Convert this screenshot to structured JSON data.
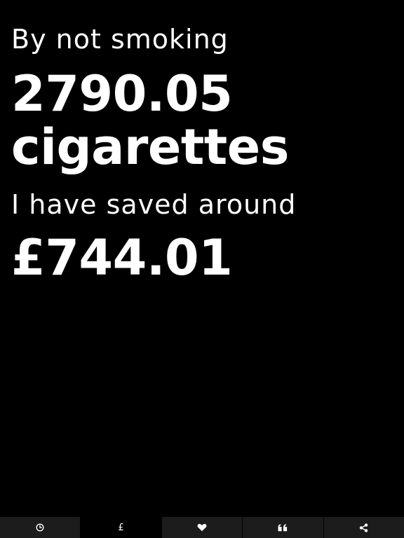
{
  "intro": "By not smoking",
  "cigarettes": {
    "count": "2790.05",
    "unit": "cigarettes"
  },
  "saved_label": "I have saved around",
  "saved_amount": "£744.01",
  "tabs": [
    {
      "icon": "clock-icon",
      "label": "",
      "active": false
    },
    {
      "icon": "pound-icon",
      "label": "£",
      "active": true
    },
    {
      "icon": "heart-icon",
      "label": "",
      "active": false
    },
    {
      "icon": "quote-icon",
      "label": "",
      "active": false
    },
    {
      "icon": "share-icon",
      "label": "",
      "active": false
    }
  ],
  "colors": {
    "background": "#000000",
    "text": "#ffffff",
    "tab_inactive": "#1c1c1c",
    "tab_active": "#000000"
  }
}
